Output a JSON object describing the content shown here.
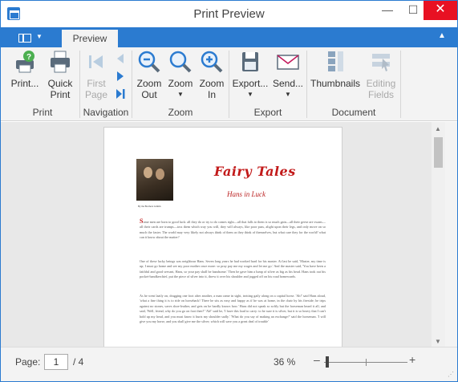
{
  "window": {
    "title": "Print Preview"
  },
  "ribbon": {
    "tab_label": "Preview",
    "groups": {
      "print": {
        "label": "Print",
        "print_button": "Print...",
        "quick_print_line1": "Quick",
        "quick_print_line2": "Print"
      },
      "navigation": {
        "label": "Navigation",
        "first_page_line1": "First",
        "first_page_line2": "Page"
      },
      "zoom": {
        "label": "Zoom",
        "zoom_out_line1": "Zoom",
        "zoom_out_line2": "Out",
        "zoom_button": "Zoom",
        "zoom_in_line1": "Zoom",
        "zoom_in_line2": "In"
      },
      "export": {
        "label": "Export",
        "export_button": "Export...",
        "send_button": "Send..."
      },
      "document": {
        "label": "Document",
        "thumbnails_button": "Thumbnails",
        "editing_fields_line1": "Editing",
        "editing_fields_line2": "Fields"
      }
    }
  },
  "preview_page": {
    "title": "Fairy Tales",
    "subtitle": "Hans in Luck",
    "caption": "By the Brothers Grimm",
    "paragraphs": [
      "Some men are born to good luck: all they do or try to do comes right—all that falls to them is so much gain—all their geese are swans—all their cards are trumps—toss them which way you will, they will always, like poor puss, alight upon their legs, and only move on so much the faster. The world may very likely not always think of them as they think of themselves, but what care they for the world? what can it know about the matter?",
      "One of these lucky beings was neighbour Hans. Seven long years he had worked hard for his master. At last he said, 'Master, my time is up; I must go home and see my poor mother once more: so pray pay me my wages and let me go.' And the master said, 'You have been a faithful and good servant, Hans, so your pay shall be handsome.' Then he gave him a lump of silver as big as his head. Hans took out his pocket-handkerchief, put the piece of silver into it, threw it over his shoulder and jogged off on his road homewards.",
      "As he went lazily on, dragging one foot after another, a man came in sight, trotting gaily along on a capital horse. 'Ah!' said Hans aloud, 'what a fine thing it is to ride on horseback! There he sits as easy and happy as if he was at home, in the chair by his fireside; he trips against no stones, saves shoe-leather, and gets on he hardly knows how.' Hans did not speak so softly but the horseman heard it all, and said, 'Well, friend, why do you go on foot then?' 'Ah!' said he, 'I have this load to carry: to be sure it is silver, but it is so heavy that I can't hold up my head, and you must know it hurts my shoulder sadly.' 'What do you say of making an exchange?' said the horseman. 'I will give you my horse, and you shall give me the silver; which will save you a great deal of trouble'"
    ]
  },
  "statusbar": {
    "page_label": "Page:",
    "page_current": "1",
    "page_total": "/ 4",
    "zoom_value": "36 %",
    "zoom_fraction": 0.36
  },
  "colors": {
    "accent": "#2b7bd0",
    "title_red": "#c21a1a",
    "close_red": "#e81123"
  }
}
